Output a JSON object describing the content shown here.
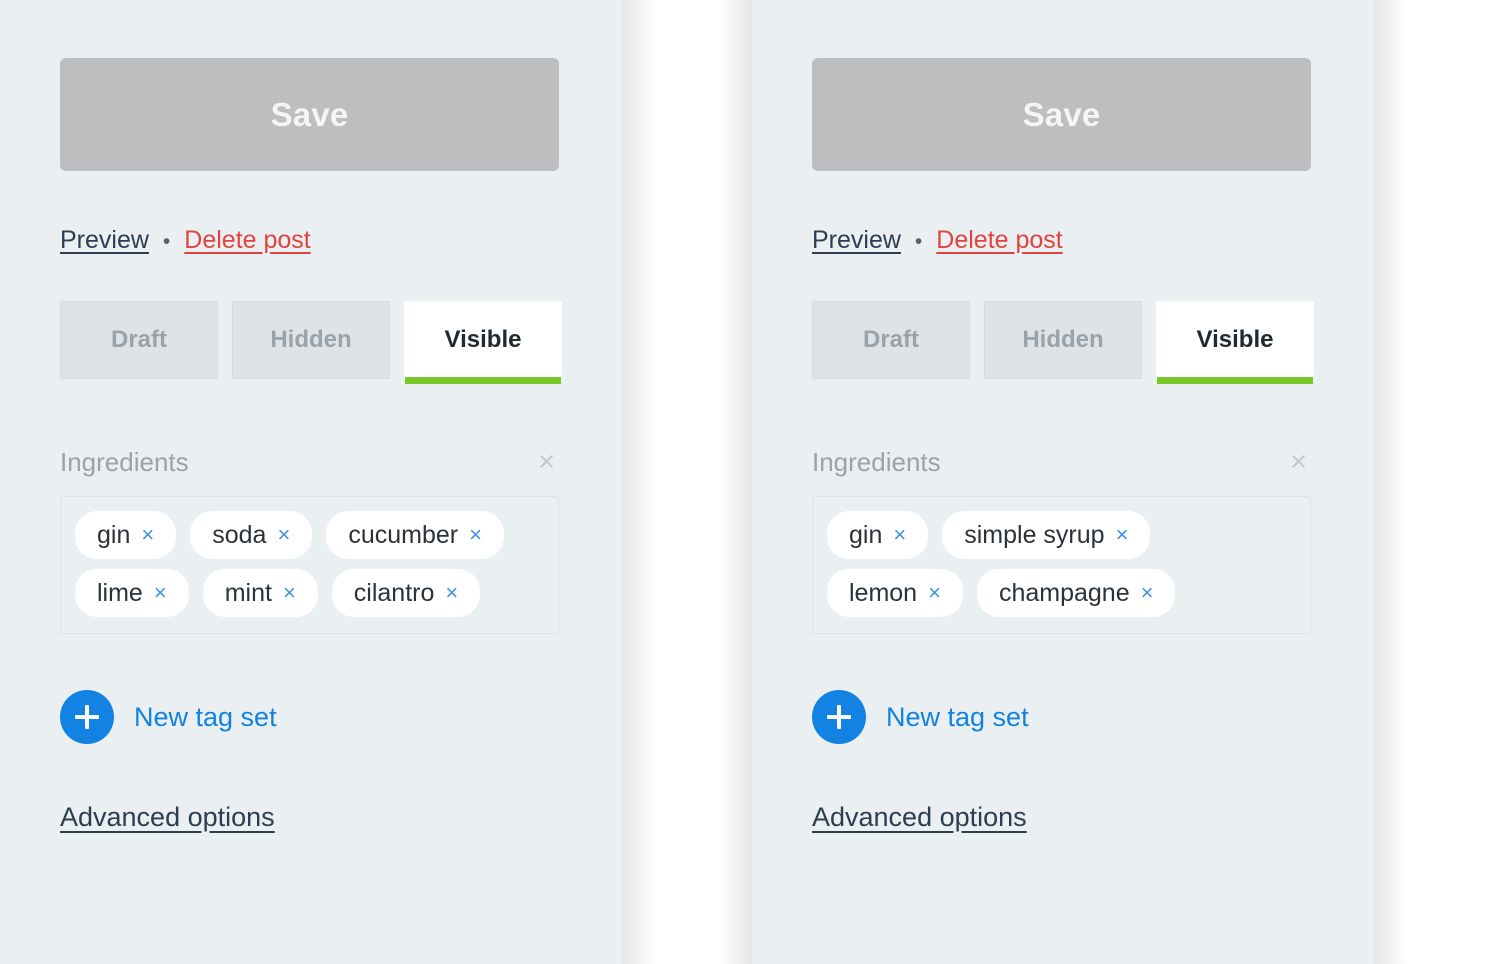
{
  "theme": {
    "panel_bg": "#eaeff1",
    "save_bg": "#bcbec0",
    "accent_green": "#7ac729",
    "accent_blue": "#1283e2",
    "tag_x_blue": "#3e92e0",
    "delete_red": "#e2433f"
  },
  "panels": [
    {
      "id": "left",
      "save_label": "Save",
      "preview_label": "Preview",
      "separator": "•",
      "delete_label": "Delete post",
      "tabs": [
        {
          "label": "Draft",
          "active": false
        },
        {
          "label": "Hidden",
          "active": false
        },
        {
          "label": "Visible",
          "active": true
        }
      ],
      "group": {
        "title": "Ingredients",
        "close_icon": "×",
        "tags": [
          {
            "label": "gin",
            "remove_icon": "×"
          },
          {
            "label": "soda",
            "remove_icon": "×"
          },
          {
            "label": "cucumber",
            "remove_icon": "×"
          },
          {
            "label": "lime",
            "remove_icon": "×"
          },
          {
            "label": "mint",
            "remove_icon": "×"
          },
          {
            "label": "cilantro",
            "remove_icon": "×"
          }
        ]
      },
      "new_tag_set_label": "New tag set",
      "advanced_label": "Advanced options"
    },
    {
      "id": "right",
      "save_label": "Save",
      "preview_label": "Preview",
      "separator": "•",
      "delete_label": "Delete post",
      "tabs": [
        {
          "label": "Draft",
          "active": false
        },
        {
          "label": "Hidden",
          "active": false
        },
        {
          "label": "Visible",
          "active": true
        }
      ],
      "group": {
        "title": "Ingredients",
        "close_icon": "×",
        "tags": [
          {
            "label": "gin",
            "remove_icon": "×"
          },
          {
            "label": "simple syrup",
            "remove_icon": "×"
          },
          {
            "label": "lemon",
            "remove_icon": "×"
          },
          {
            "label": "champagne",
            "remove_icon": "×"
          }
        ]
      },
      "new_tag_set_label": "New tag set",
      "advanced_label": "Advanced options"
    }
  ]
}
